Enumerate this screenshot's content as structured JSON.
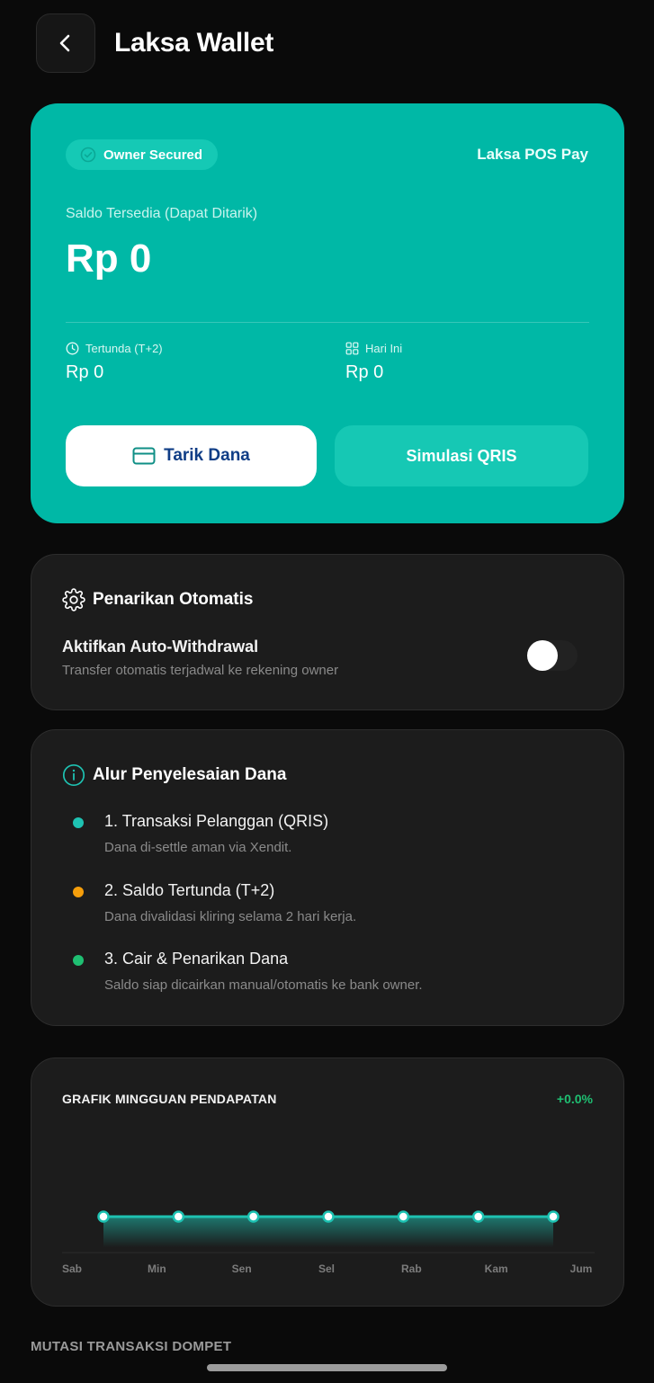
{
  "header": {
    "title": "Laksa Wallet"
  },
  "balance_card": {
    "badge": "Owner Secured",
    "brand": "Laksa POS Pay",
    "saldo_label": "Saldo Tersedia (Dapat Ditarik)",
    "saldo_amount": "Rp 0",
    "pending_label": "Tertunda (T+2)",
    "pending_value": "Rp 0",
    "today_label": "Hari Ini",
    "today_value": "Rp 0",
    "withdraw_label": "Tarik Dana",
    "qris_label": "Simulasi QRIS",
    "colors": {
      "card_bg": "#00b8a6",
      "withdraw_text": "#0f3d86"
    }
  },
  "auto_withdraw": {
    "title": "Penarikan Otomatis",
    "toggle_title": "Aktifkan Auto-Withdrawal",
    "toggle_desc": "Transfer otomatis terjadwal ke rekening owner",
    "enabled": false
  },
  "flow": {
    "title": "Alur Penyelesaian Dana",
    "steps": [
      {
        "title": "1. Transaksi Pelanggan (QRIS)",
        "desc": "Dana di-settle aman via Xendit.",
        "color": "#1ec2b2"
      },
      {
        "title": "2. Saldo Tertunda (T+2)",
        "desc": "Dana divalidasi kliring selama 2 hari kerja.",
        "color": "#f59e0b"
      },
      {
        "title": "3. Cair & Penarikan Dana",
        "desc": "Saldo siap dicairkan manual/otomatis ke bank owner.",
        "color": "#1fbf72"
      }
    ]
  },
  "chart_section": {
    "title": "GRAFIK MINGGUAN PENDAPATAN",
    "change": "+0.0%"
  },
  "chart_data": {
    "type": "area",
    "title": "GRAFIK MINGGUAN PENDAPATAN",
    "x_labels": [
      "Sab",
      "Min",
      "Sen",
      "Sel",
      "Rab",
      "Kam",
      "Jum"
    ],
    "series": [
      {
        "values": [
          0,
          0,
          0,
          0,
          0,
          0,
          0
        ]
      }
    ],
    "line_color": "#1ec2b2",
    "grid": false
  },
  "mutasi": {
    "label": "MUTASI TRANSAKSI DOMPET"
  }
}
